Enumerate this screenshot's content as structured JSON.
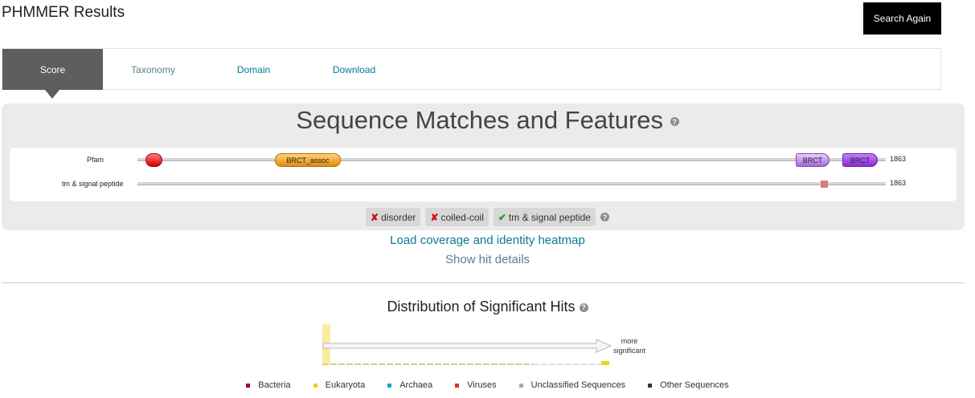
{
  "header": {
    "title": "PHMMER Results",
    "search_again_label": "Search Again"
  },
  "tabs": [
    {
      "label": "Score",
      "active": true
    },
    {
      "label": "Taxonomy",
      "active": false
    },
    {
      "label": "Domain",
      "active": false
    },
    {
      "label": "Download",
      "active": false
    }
  ],
  "features": {
    "title": "Sequence Matches and Features",
    "help_icon": "question-circle",
    "tracks": [
      {
        "label": "Pfam",
        "length": "1863",
        "domains": [
          {
            "name": "",
            "color": "#e01010"
          },
          {
            "name": "BRCT_assoc",
            "color": "#f0a020"
          },
          {
            "name": "BRCT",
            "color": "#c9a2ee"
          },
          {
            "name": "BRCT",
            "color": "#a040e0"
          }
        ]
      },
      {
        "label": "tm & signal peptide",
        "length": "1863"
      }
    ],
    "toggles": [
      {
        "label": "disorder",
        "enabled": false,
        "icon": "x-mark"
      },
      {
        "label": "coiled-coil",
        "enabled": false,
        "icon": "x-mark"
      },
      {
        "label": "tm & signal peptide",
        "enabled": true,
        "icon": "check-mark"
      }
    ]
  },
  "links": {
    "load_heatmap": "Load coverage and identity heatmap",
    "show_hit_details": "Show hit details"
  },
  "distribution": {
    "title": "Distribution of Significant Hits",
    "arrow_label_line1": "more",
    "arrow_label_line2": "significant",
    "legend": [
      {
        "label": "Bacteria",
        "color": "#a30d1c"
      },
      {
        "label": "Eukaryota",
        "color": "#f2d21b"
      },
      {
        "label": "Archaea",
        "color": "#1aa3c9"
      },
      {
        "label": "Viruses",
        "color": "#e0282b"
      },
      {
        "label": "Unclassified Sequences",
        "color": "#a8a8a8"
      },
      {
        "label": "Other Sequences",
        "color": "#333333"
      }
    ]
  }
}
